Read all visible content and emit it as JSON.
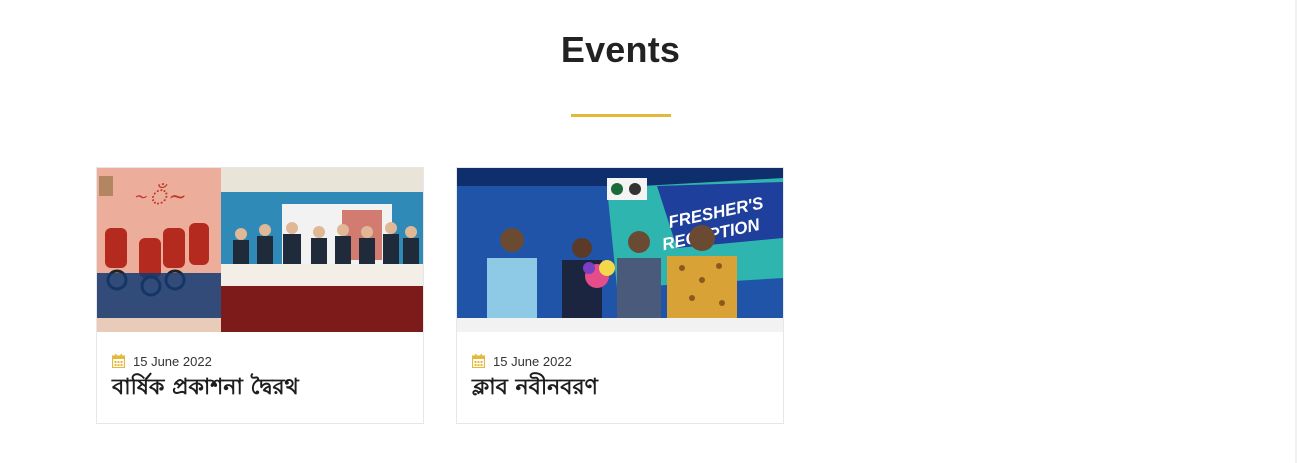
{
  "section": {
    "title": "Events",
    "accent_color": "#e3b93c"
  },
  "events": [
    {
      "date": "15 June 2022",
      "title": "বার্ষিক প্রকাশনা দ্বৈরথ",
      "icon": "calendar-icon"
    },
    {
      "date": "15 June 2022",
      "title": "ক্লাব নবীনবরণ",
      "icon": "calendar-icon"
    }
  ]
}
